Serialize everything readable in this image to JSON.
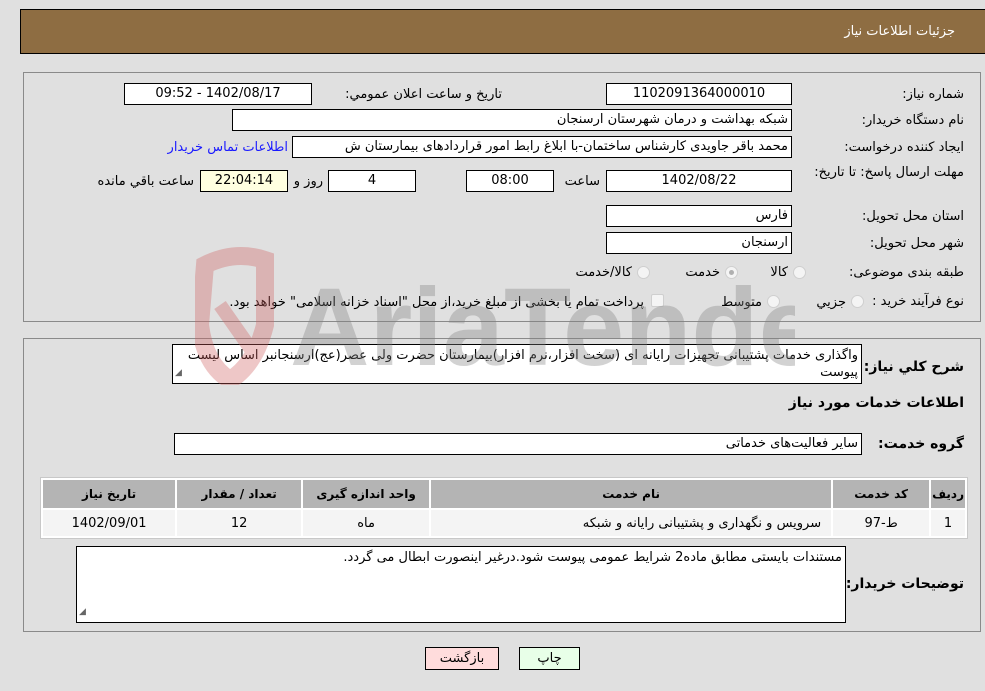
{
  "header": {
    "title": "جزئیات اطلاعات نیاز"
  },
  "form": {
    "need_number_label": "شماره نیاز:",
    "need_number": "1102091364000010",
    "announce_label": "تاريخ و ساعت اعلان عمومي:",
    "announce_value": "1402/08/17 - 09:52",
    "buyer_org_label": "نام دستگاه خريدار:",
    "buyer_org": "شبکه بهداشت و درمان شهرستان ارسنجان",
    "creator_label": "ايجاد کننده درخواست:",
    "creator": "محمد باقر جاويدی کارشناس ساختمان-با ابلاغ رابط امور قراردادهای بيمارستان ش",
    "contact_link": "اطلاعات تماس خريدار",
    "deadline_label": "مهلت ارسال پاسخ: تا تاریخ:",
    "deadline_date": "1402/08/22",
    "time_label": "ساعت",
    "deadline_time": "08:00",
    "days": "4",
    "days_label": "روز و",
    "remaining_time": "22:04:14",
    "remaining_label": "ساعت باقي مانده",
    "province_label": "استان محل تحويل:",
    "province": "فارس",
    "city_label": "شهر محل تحويل:",
    "city": "ارسنجان",
    "category_label": "طبقه بندی موضوعی:",
    "category_options": [
      {
        "label": "کالا",
        "checked": false
      },
      {
        "label": "خدمت",
        "checked": true
      },
      {
        "label": "کالا/خدمت",
        "checked": false
      }
    ],
    "process_label": "نوع فرآيند خريد :",
    "process_options": [
      {
        "label": "جزيي",
        "checked": false
      },
      {
        "label": "متوسط",
        "checked": false
      }
    ],
    "treasury_note": "پرداخت تمام يا بخشی از مبلغ خريد،از محل \"اسناد خزانه اسلامی\" خواهد بود.",
    "treasury_checked": false
  },
  "details": {
    "summary_label": "شرح کلي نياز:",
    "summary": "واگذاری خدمات پشتيبانی تجهيزات رايانه ای (سخت افزار،نرم افزار)بيمارستان حضرت ولی عصر(عج)ارسنجانبر اساس ليست پيوست",
    "services_heading": "اطلاعات خدمات مورد نياز",
    "service_group_label": "گروه خدمت:",
    "service_group": "ساير فعاليت‌های خدماتی",
    "table": {
      "headers": [
        "رديف",
        "کد خدمت",
        "نام خدمت",
        "واحد اندازه گيری",
        "تعداد / مقدار",
        "تاريخ نياز"
      ],
      "rows": [
        [
          "1",
          "ط-97",
          "سرويس و نگهداری و پشتيبانی رايانه و شبکه",
          "ماه",
          "12",
          "1402/09/01"
        ]
      ]
    },
    "buyer_notes_label": "توضيحات خريدار:",
    "buyer_notes": "مستندات بايستی مطابق ماده2 شرايط عمومی پيوست شود.درغير اينصورت ابطال می گردد."
  },
  "buttons": {
    "print": "چاپ",
    "back": "بازگشت"
  },
  "watermark": {
    "text": "AriaTender.neT"
  }
}
